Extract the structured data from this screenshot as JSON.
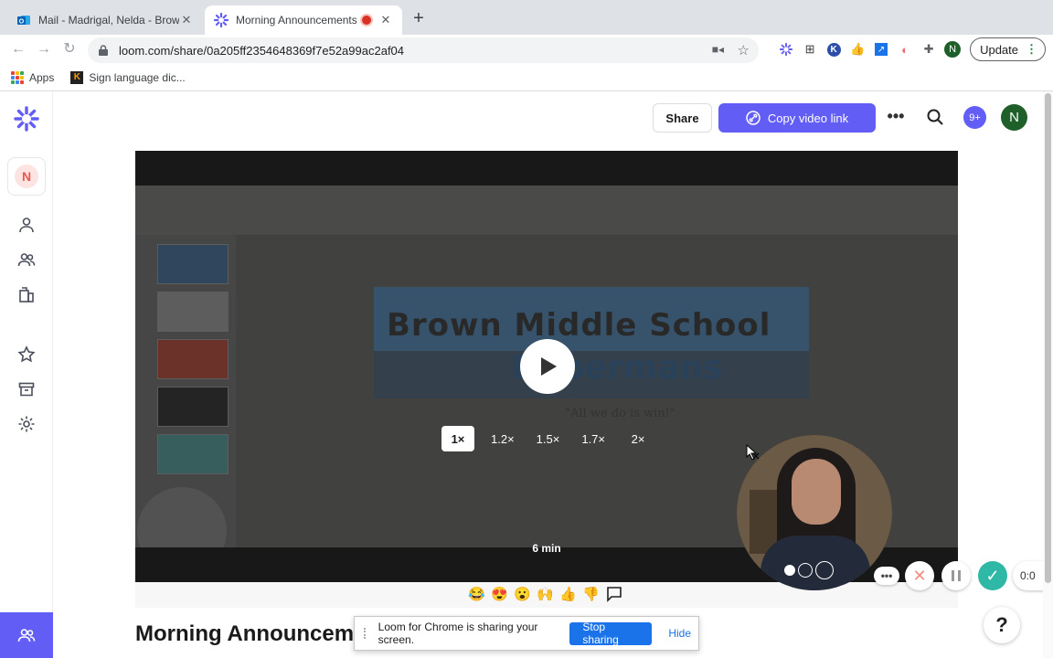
{
  "browser": {
    "tabs": [
      {
        "title": "Mail - Madrigal, Nelda - Brown",
        "favicon": "outlook-icon"
      },
      {
        "title": "Morning Announcements 9",
        "favicon": "loom-icon"
      }
    ],
    "url": "loom.com/share/0a205ff2354648369f7e52a99ac2af04",
    "update_label": "Update",
    "profile_initial": "N",
    "bookmarks": [
      {
        "label": "Apps",
        "icon": "apps-grid-icon"
      },
      {
        "label": "Sign language dic...",
        "icon": "sign-language-icon"
      }
    ]
  },
  "loom": {
    "workspace_initial": "N",
    "share_label": "Share",
    "copy_link_label": "Copy video link",
    "notifications_badge": "9+",
    "avatar_initial": "N",
    "video": {
      "slide_heading_1": "Brown Middle School",
      "slide_heading_2": "Dobermans",
      "slide_quote": "\"All we do is win!\"",
      "speeds": [
        "1×",
        "1.2×",
        "1.5×",
        "1.7×",
        "2×"
      ],
      "selected_speed": "1×",
      "duration": "6 min"
    },
    "title": "Morning Announcements",
    "reactions": [
      "😂",
      "😍",
      "😮",
      "🙌",
      "👍",
      "👎"
    ]
  },
  "recorder": {
    "timer": "0:0"
  },
  "sharebar": {
    "message": "Loom for Chrome is sharing your screen.",
    "stop_label": "Stop sharing",
    "hide_label": "Hide"
  },
  "colors": {
    "loom_purple": "#625df5",
    "tab_strip": "#dee1e6",
    "chrome_blue": "#1a73e8",
    "record_green": "#2fb8a5"
  }
}
